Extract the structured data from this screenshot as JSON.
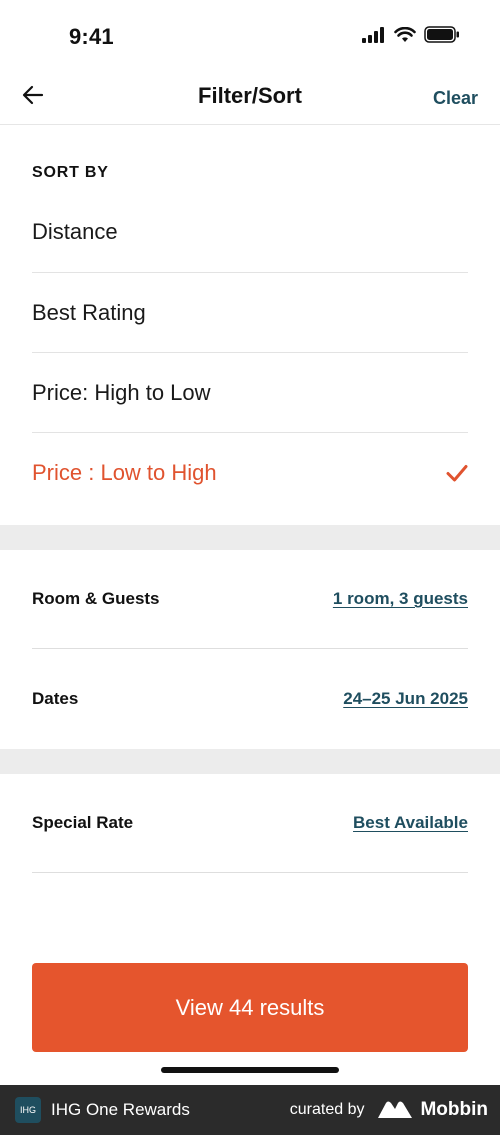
{
  "status_bar": {
    "time": "9:41"
  },
  "nav": {
    "title": "Filter/Sort",
    "clear_label": "Clear"
  },
  "sort": {
    "heading": "SORT BY",
    "options": [
      {
        "label": "Distance",
        "selected": false
      },
      {
        "label": "Best Rating",
        "selected": false
      },
      {
        "label": "Price: High to Low",
        "selected": false
      },
      {
        "label": "Price : Low to High",
        "selected": true
      }
    ]
  },
  "filters": {
    "room_guests": {
      "label": "Room & Guests",
      "value": "1 room, 3 guests"
    },
    "dates": {
      "label": "Dates",
      "value": "24–25 Jun 2025"
    },
    "special_rate": {
      "label": "Special Rate",
      "value": "Best Available"
    }
  },
  "cta": {
    "label": "View 44 results"
  },
  "footer": {
    "app_name": "IHG One Rewards",
    "logo_text": "IHG",
    "curated_by": "curated by",
    "brand": "Mobbin"
  },
  "colors": {
    "accent": "#e5552d",
    "link": "#1f4e5f",
    "selected_text": "#e0532f"
  }
}
